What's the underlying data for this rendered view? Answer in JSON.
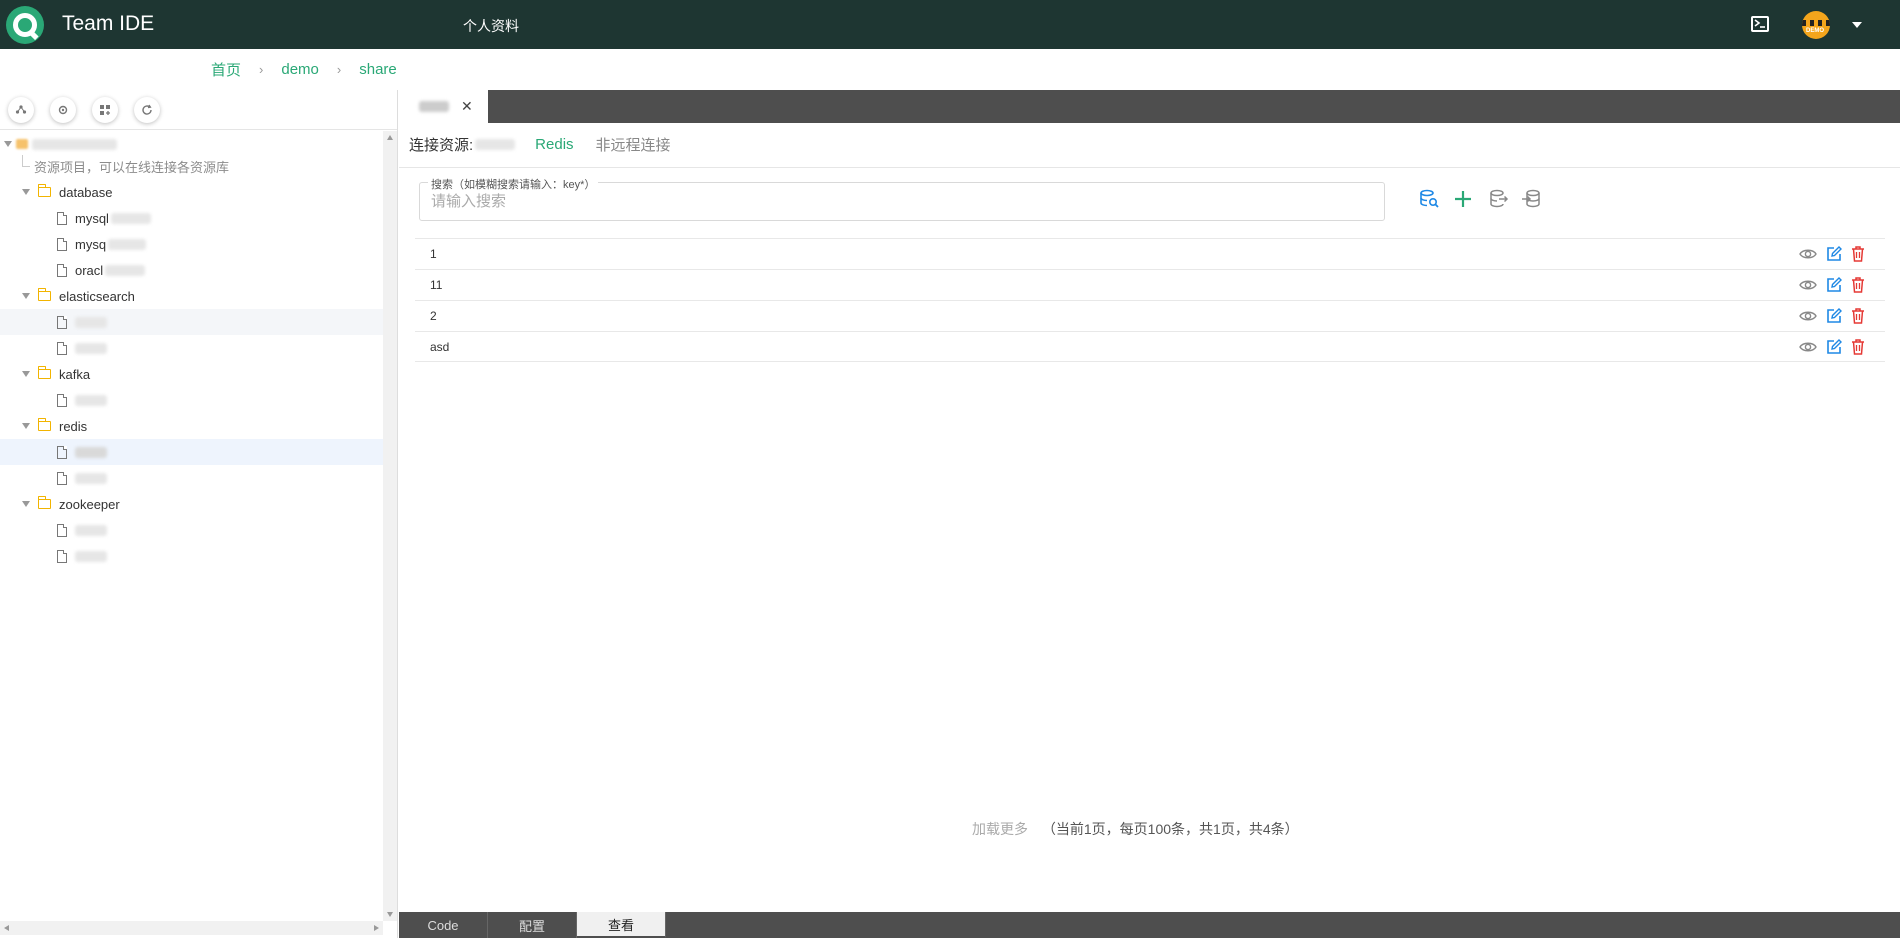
{
  "header": {
    "app_title": "Team IDE",
    "nav_profile": "个人资料",
    "avatar_text": "DEMO"
  },
  "breadcrumb": [
    "首页",
    "demo",
    "share"
  ],
  "tree": {
    "root_desc": "资源项目，可以在线连接各资源库",
    "groups": [
      {
        "name": "database",
        "items": [
          "mysql",
          "mysq",
          "oracl"
        ]
      },
      {
        "name": "elasticsearch",
        "items": [
          "",
          ""
        ]
      },
      {
        "name": "kafka",
        "items": [
          ""
        ]
      },
      {
        "name": "redis",
        "items": [
          "",
          ""
        ]
      },
      {
        "name": "zookeeper",
        "items": [
          "",
          ""
        ]
      }
    ]
  },
  "connection": {
    "label": "连接资源:",
    "type": "Redis",
    "mode": "非远程连接"
  },
  "search": {
    "legend": "搜索（如模糊搜索请输入：key*）",
    "placeholder": "请输入搜索",
    "value": ""
  },
  "keys": [
    "1",
    "11",
    "2",
    "asd"
  ],
  "pager": {
    "more": "加载更多",
    "info": "（当前1页，每页100条，共1页，共4条）"
  },
  "bottom_tabs": [
    "Code",
    "配置",
    "查看"
  ],
  "colors": {
    "header_bg": "#1e3632",
    "accent": "#2aa876",
    "folder": "#f2b400",
    "edit": "#1e88e5",
    "delete": "#e53935"
  }
}
